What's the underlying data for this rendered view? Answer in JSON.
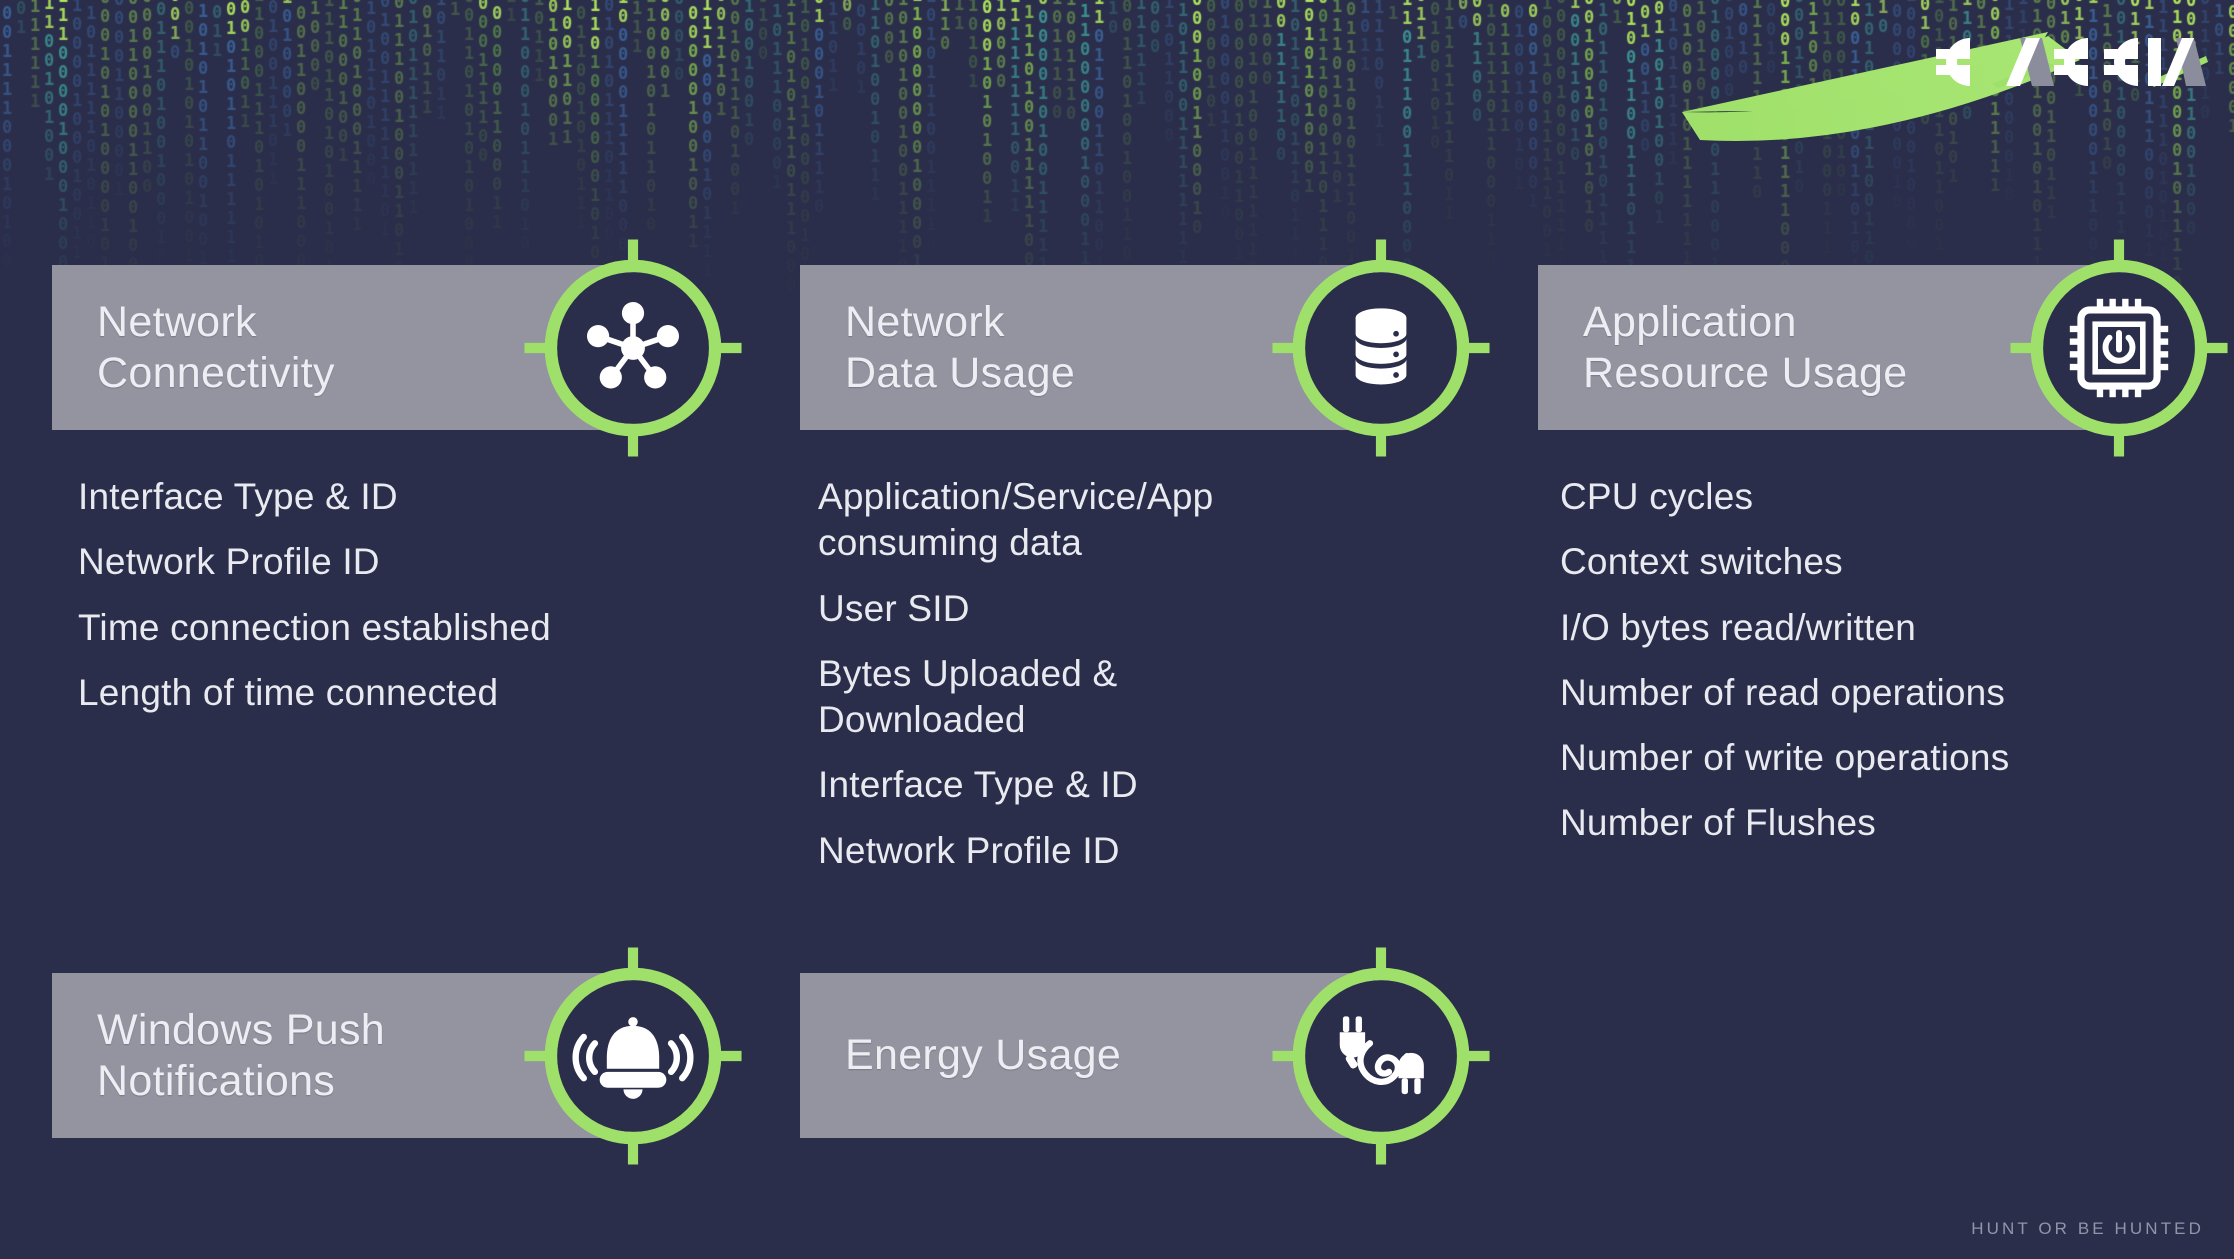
{
  "brand": {
    "logo_text": "CACCIA",
    "tagline": "HUNT OR BE HUNTED",
    "accent_green": "#9fe06a",
    "background_navy": "#2b2e4a",
    "bar_gray": "#93949f",
    "text_light": "#e8eaf0"
  },
  "background": {
    "style": "matrix-binary-rain",
    "glyphs": "0 1",
    "colors": [
      "#8fd14f",
      "#3fa7a0",
      "#3d6ba8",
      "#5b8f4a"
    ]
  },
  "cards": [
    {
      "id": "network-connectivity",
      "title": "Network\nConnectivity",
      "icon": "network-nodes-icon",
      "bullets": [
        "Interface Type & ID",
        "Network Profile ID",
        "Time connection established",
        "Length of time connected"
      ]
    },
    {
      "id": "network-data-usage",
      "title": "Network\nData Usage",
      "icon": "database-icon",
      "bullets": [
        "Application/Service/App\nconsuming data",
        "User SID",
        "Bytes Uploaded &\nDownloaded",
        "Interface Type & ID",
        "Network Profile ID"
      ]
    },
    {
      "id": "application-resource-usage",
      "title": "Application\nResource Usage",
      "icon": "cpu-chip-icon",
      "bullets": [
        "CPU cycles",
        "Context switches",
        "I/O bytes read/written",
        "Number of read operations",
        "Number of write operations",
        "Number of Flushes"
      ]
    },
    {
      "id": "windows-push-notifications",
      "title": "Windows Push\nNotifications",
      "icon": "bell-notification-icon",
      "bullets": []
    },
    {
      "id": "energy-usage",
      "title": "Energy Usage",
      "icon": "power-plug-icon",
      "bullets": []
    }
  ]
}
